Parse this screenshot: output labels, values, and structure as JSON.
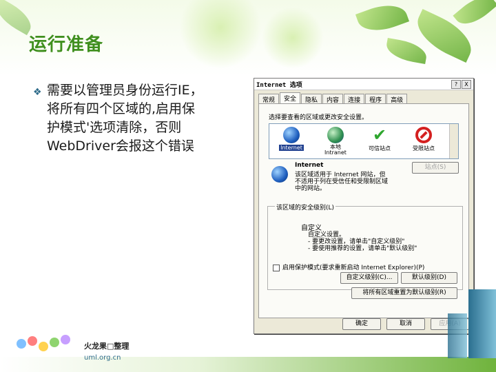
{
  "slide": {
    "title": "运行准备",
    "bullet_symbol": "❖",
    "bullet_text": "需要以管理员身份运行IE，\n将所有四个区域的,启用保\n护模式'选项清除，否则\nWebDriver会报这个错误"
  },
  "dialog": {
    "title": "Internet 选项",
    "help_btn": "?",
    "close_btn": "X",
    "tabs": [
      "常规",
      "安全",
      "隐私",
      "内容",
      "连接",
      "程序",
      "高级"
    ],
    "active_tab": 1,
    "prompt": "选择要查看的区域或更改安全设置。",
    "zones": [
      {
        "label": "Internet",
        "icon": "globe-icon"
      },
      {
        "label": "本地\nIntranet",
        "icon": "local-intranet-icon"
      },
      {
        "label": "可信站点",
        "icon": "checkmark-icon"
      },
      {
        "label": "受限站点",
        "icon": "forbidden-icon"
      }
    ],
    "zone_info_name": "Internet",
    "zone_info_desc": "该区域适用于 Internet 网站，但\n不适用于列在受信任和受限制区域\n中的网站。",
    "sites_btn": "站点(S)",
    "security_group_title": "该区域的安全级别(L)",
    "custom_title": "自定义",
    "custom_lines": "自定义设置。\n- 要更改设置，请单击\"自定义级别\"\n- 要使用推荐的设置，请单击\"默认级别\"",
    "protected_mode_label": "启用保护模式(要求重新启动 Internet Explorer)(P)",
    "custom_level_btn": "自定义级别(C)...",
    "default_level_btn": "默认级别(D)",
    "reset_all_btn": "将所有区域重置为默认级别(R)",
    "ok_btn": "确定",
    "cancel_btn": "取消",
    "apply_btn": "应用(A)"
  },
  "footer": {
    "org_name": "火龙果□整理",
    "org_url": "uml.org.cn"
  },
  "colors": {
    "title_green": "#3f8f1e",
    "accent_blue": "#2e6b8a"
  }
}
